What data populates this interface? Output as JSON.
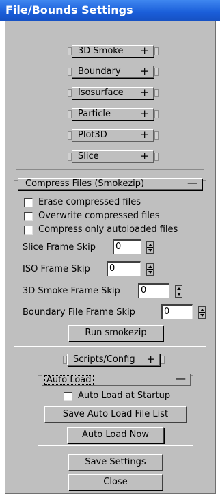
{
  "window": {
    "title": "File/Bounds Settings"
  },
  "rollouts": [
    {
      "label": "3D Smoke",
      "icon": "plus-icon"
    },
    {
      "label": "Boundary",
      "icon": "plus-icon"
    },
    {
      "label": "Isosurface",
      "icon": "plus-icon"
    },
    {
      "label": "Particle",
      "icon": "plus-icon"
    },
    {
      "label": "Plot3D",
      "icon": "plus-icon"
    },
    {
      "label": "Slice",
      "icon": "plus-icon"
    }
  ],
  "compress": {
    "header": "Compress Files (Smokezip)",
    "checkboxes": [
      {
        "label": "Erase compressed files",
        "checked": false
      },
      {
        "label": "Overwrite compressed files",
        "checked": false
      },
      {
        "label": "Compress only autoloaded files",
        "checked": false
      }
    ],
    "fields": [
      {
        "label": "Slice Frame Skip",
        "value": "0"
      },
      {
        "label": "ISO Frame Skip",
        "value": "0"
      },
      {
        "label": "3D Smoke Frame Skip",
        "value": "0"
      },
      {
        "label": "Boundary File Frame Skip",
        "value": "0"
      }
    ],
    "run_button": "Run smokezip"
  },
  "scripts": {
    "label": "Scripts/Config",
    "icon": "plus-icon"
  },
  "autoload": {
    "header": "Auto Load",
    "checkbox": {
      "label": "Auto Load at Startup",
      "checked": false
    },
    "save_list_button": "Save Auto Load File List",
    "load_now_button": "Auto Load Now"
  },
  "footer": {
    "save_button": "Save Settings",
    "close_button": "Close"
  }
}
